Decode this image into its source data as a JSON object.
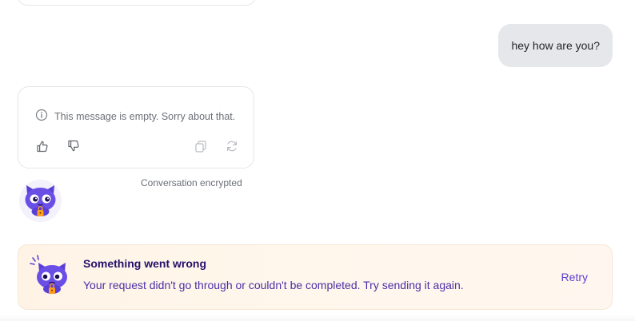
{
  "conversation": {
    "user_message": "hey how are you?",
    "bot_message": {
      "empty_notice": "This message is empty. Sorry about that.",
      "notice_icon": "info-circle-icon",
      "actions": {
        "like_icon": "thumbs-up-icon",
        "dislike_icon": "thumbs-down-icon",
        "copy_icon": "copy-icon",
        "regenerate_icon": "refresh-icon"
      }
    },
    "encryption_note": "Conversation encrypted",
    "avatar_icon": "cat-mascot-icon"
  },
  "error_banner": {
    "title": "Something went wrong",
    "message": "Your request didn't go through or couldn't be completed. Try sending it again.",
    "retry_label": "Retry",
    "mascot_icon": "worried-cat-mascot-icon"
  },
  "colors": {
    "user_bubble_bg": "#e5e7eb",
    "brand_purple": "#5b3fd0",
    "error_title": "#25106b",
    "error_banner_bg": "#fff3e6"
  }
}
